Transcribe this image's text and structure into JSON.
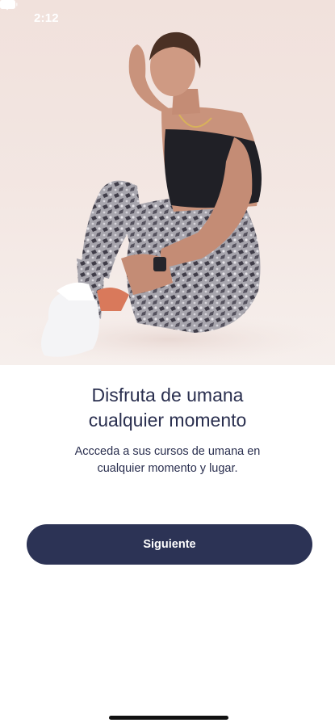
{
  "status_bar": {
    "time": "2:12",
    "icons": [
      "wifi-icon",
      "battery-icon"
    ]
  },
  "hero": {
    "image": "woman-in-sportswear-sitting-photo",
    "background_color": "#f2e4df"
  },
  "onboarding": {
    "title_lines": [
      "Disfruta de umana",
      "cualquier momento"
    ],
    "subtitle_lines": [
      "Accceda a sus cursos de umana en",
      "cualquier momento y lugar."
    ],
    "next_button_label": "Siguiente"
  },
  "colors": {
    "primary": "#2c3355",
    "text": "#2a2f4f",
    "background": "#ffffff"
  }
}
